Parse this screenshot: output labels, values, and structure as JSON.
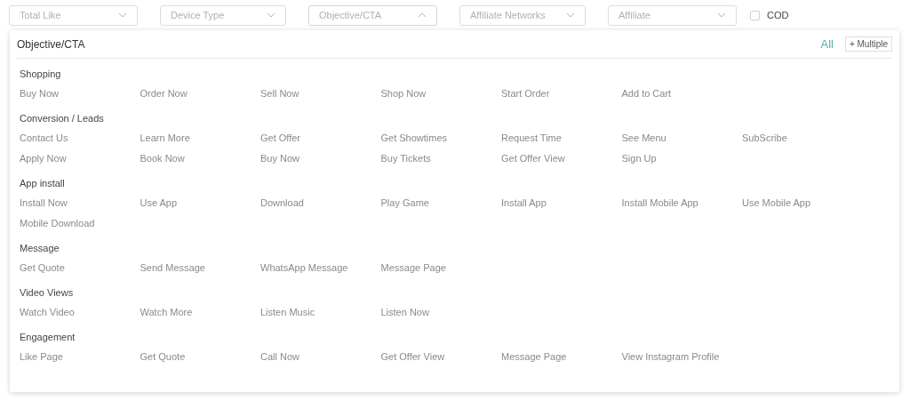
{
  "filters": [
    {
      "placeholder": "Total Like",
      "expanded": false
    },
    {
      "placeholder": "Device Type",
      "expanded": false
    },
    {
      "placeholder": "Objective/CTA",
      "expanded": true
    },
    {
      "placeholder": "Affiliate Networks",
      "expanded": false
    },
    {
      "placeholder": "Affiliate",
      "expanded": false
    }
  ],
  "cod": {
    "label": "COD",
    "checked": false
  },
  "panel": {
    "title": "Objective/CTA",
    "all_link": "All",
    "multiple_button": "+ Multiple",
    "groups": [
      {
        "title": "Shopping",
        "items": [
          "Buy Now",
          "Order Now",
          "Sell Now",
          "Shop Now",
          "Start Order",
          "Add to Cart"
        ]
      },
      {
        "title": "Conversion / Leads",
        "items": [
          "Contact Us",
          "Learn More",
          "Get Offer",
          "Get Showtimes",
          "Request Time",
          "See Menu",
          "SubScribe",
          "Apply Now",
          "Book Now",
          "Buy Now",
          "Buy Tickets",
          "Get Offer View",
          "Sign Up"
        ]
      },
      {
        "title": "App install",
        "items": [
          "Install Now",
          "Use App",
          "Download",
          "Play Game",
          "Install App",
          "Install Mobile App",
          "Use Mobile App",
          "Mobile Download"
        ]
      },
      {
        "title": "Message",
        "items": [
          "Get Quote",
          "Send Message",
          "WhatsApp Message",
          "Message Page"
        ]
      },
      {
        "title": "Video Views",
        "items": [
          "Watch Video",
          "Watch More",
          "Listen Music",
          "Listen Now"
        ]
      },
      {
        "title": "Engagement",
        "items": [
          "Like Page",
          "Get Quote",
          "Call Now",
          "Get Offer View",
          "Message Page",
          "View Instagram Profile"
        ]
      }
    ]
  }
}
